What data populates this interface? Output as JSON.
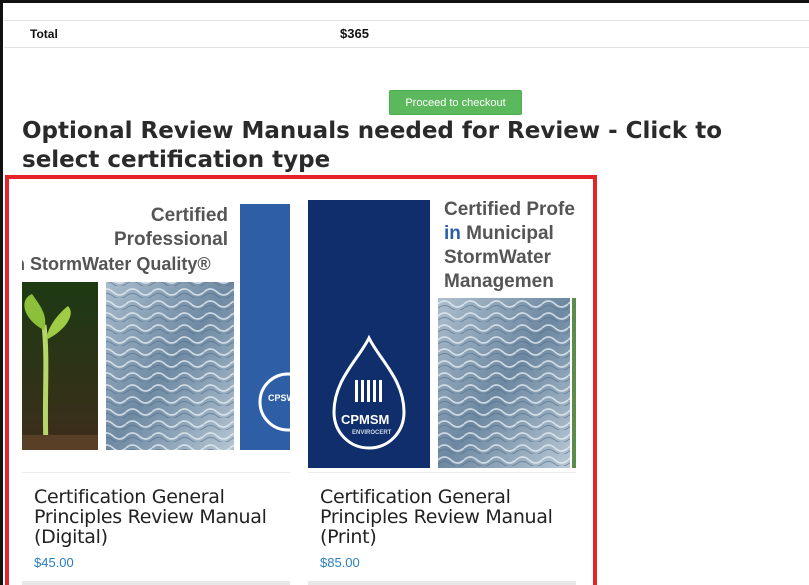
{
  "cart": {
    "total_label": "Total",
    "total_value": "$365"
  },
  "checkout": {
    "button_label": "Proceed to checkout"
  },
  "section": {
    "title": "Optional Review Manuals needed for Review - Click to select certification type"
  },
  "products": [
    {
      "image_lines": [
        "Certified",
        "Professional",
        "n StormWater Quality®"
      ],
      "logo_text": "CPSWQ",
      "title": "Certification General Principles Review Manual (Digital)",
      "price": "$45.00"
    },
    {
      "image_lines": [
        "Certified Profe",
        "in Municipal",
        "StormWater",
        "Managemen"
      ],
      "image_line2_prefix": "in",
      "image_line2_rest": " Municipal",
      "logo_text": "CPMSM",
      "logo_subtext": "ENVIROCERT",
      "title": "Certification General Principles Review Manual (Print)",
      "price": "$85.00"
    }
  ],
  "colors": {
    "checkout_green": "#5cb85c",
    "highlight_red": "#e3242b",
    "price_blue": "#2a7fc1",
    "brand_navy": "#0f2e6b"
  }
}
